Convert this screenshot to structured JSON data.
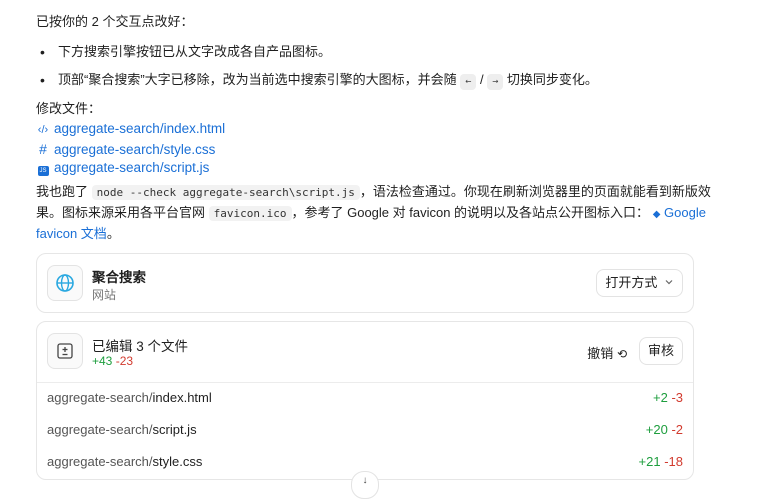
{
  "intro": "已按你的 2 个交互点改好：",
  "bullets": [
    {
      "text": "下方搜索引擎按钮已从文字改成各自产品图标。"
    },
    {
      "pre": "顶部“聚合搜索”大字已移除，改为当前选中搜索引擎的大图标，并会随",
      "key_left": "←",
      "sep": "/",
      "key_right": "→",
      "post": "切换同步变化。"
    }
  ],
  "modified_label": "修改文件：",
  "files": [
    {
      "icon": "code-icon",
      "glyph": "‹/›",
      "name": "aggregate-search/index.html"
    },
    {
      "icon": "hash-icon",
      "glyph": "#",
      "name": "aggregate-search/style.css"
    },
    {
      "icon": "js-icon",
      "glyph": "JS",
      "name": "aggregate-search/script.js"
    }
  ],
  "para": {
    "p1": "我也跑了",
    "code1": "node --check aggregate-search\\script.js",
    "p2": "，语法检查通过。你现在刷新浏览器里的页面就能看到新版效",
    "p3": "果。图标来源采用各平台官网",
    "code2": "favicon.ico",
    "p4": "，参考了 Google 对 favicon 的说明以及各站点公开图标入口：",
    "link1": "Google",
    "link2": "favicon 文档",
    "p5": "。"
  },
  "site_card": {
    "title": "聚合搜索",
    "subtitle": "网站",
    "open_button": "打开方式"
  },
  "edit_card": {
    "title": "已编辑 3 个文件",
    "additions": "+43",
    "deletions": "-23",
    "undo_button": "撤销",
    "review_button": "审核",
    "files": [
      {
        "dir": "aggregate-search/",
        "file": "index.html",
        "add": "+2",
        "del": "-3"
      },
      {
        "dir": "aggregate-search/",
        "file": "script.js",
        "add": "+20",
        "del": "-2"
      },
      {
        "dir": "aggregate-search/",
        "file": "style.css",
        "add": "+21",
        "del": "-18"
      }
    ]
  },
  "colors": {
    "link": "#1a6fd6",
    "add": "#1e9e3e",
    "del": "#d23b2f",
    "globe": "#29a8e0"
  }
}
